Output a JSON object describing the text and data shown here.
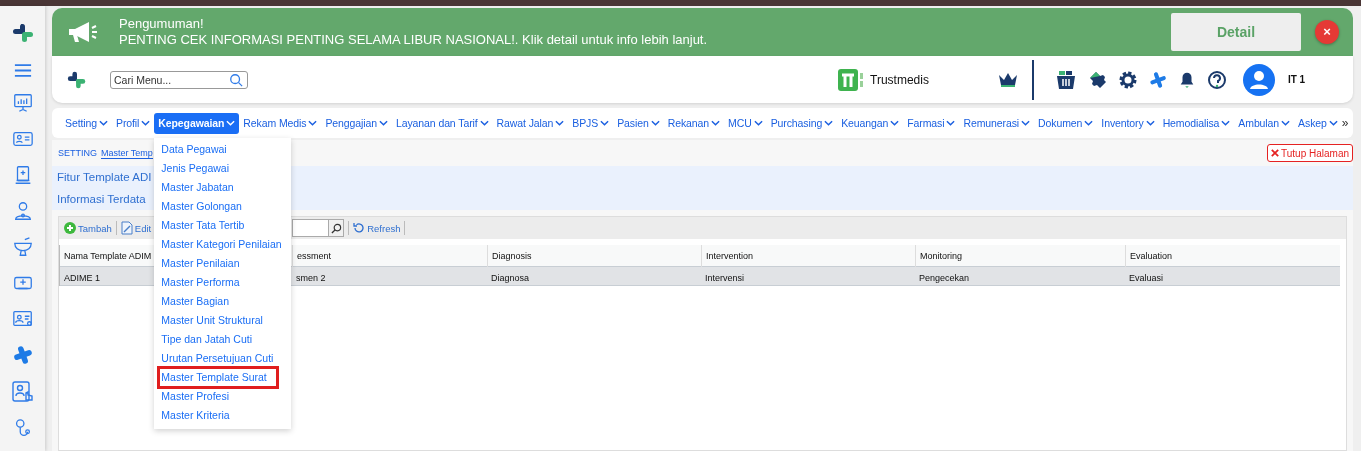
{
  "announcement": {
    "title": "Pengumuman!",
    "message": "PENTING CEK INFORMASI PENTING SELAMA LIBUR NASIONAL!. Klik detail untuk info lebih lanjut.",
    "detail_button": "Detail",
    "close_button": "×"
  },
  "header": {
    "search": {
      "placeholder": "Cari Menu..."
    },
    "brand": "Trustmedis",
    "user": "IT 1"
  },
  "menu": [
    {
      "label": "Setting",
      "selected": false
    },
    {
      "label": "Profil",
      "selected": false
    },
    {
      "label": "Kepegawaian",
      "selected": true
    },
    {
      "label": "Rekam Medis",
      "selected": false
    },
    {
      "label": "Penggajian",
      "selected": false
    },
    {
      "label": "Layanan dan Tarif",
      "selected": false
    },
    {
      "label": "Rawat Jalan",
      "selected": false
    },
    {
      "label": "BPJS",
      "selected": false
    },
    {
      "label": "Pasien",
      "selected": false
    },
    {
      "label": "Rekanan",
      "selected": false
    },
    {
      "label": "MCU",
      "selected": false
    },
    {
      "label": "Purchasing",
      "selected": false
    },
    {
      "label": "Keuangan",
      "selected": false
    },
    {
      "label": "Farmasi",
      "selected": false
    },
    {
      "label": "Remunerasi",
      "selected": false
    },
    {
      "label": "Dokumen",
      "selected": false
    },
    {
      "label": "Inventory",
      "selected": false
    },
    {
      "label": "Hemodialisa",
      "selected": false
    },
    {
      "label": "Ambulan",
      "selected": false
    },
    {
      "label": "Askep",
      "selected": false
    }
  ],
  "menu_more": "»",
  "dropdown": [
    {
      "label": "Data Pegawai",
      "highlighted": false
    },
    {
      "label": "Jenis Pegawai",
      "highlighted": false
    },
    {
      "label": "Master Jabatan",
      "highlighted": false
    },
    {
      "label": "Master Golongan",
      "highlighted": false
    },
    {
      "label": "Master Tata Tertib",
      "highlighted": false
    },
    {
      "label": "Master Kategori Penilaian",
      "highlighted": false
    },
    {
      "label": "Master Penilaian",
      "highlighted": false
    },
    {
      "label": "Master Performa",
      "highlighted": false
    },
    {
      "label": "Master Bagian",
      "highlighted": false
    },
    {
      "label": "Master Unit Struktural",
      "highlighted": false
    },
    {
      "label": "Tipe dan Jatah Cuti",
      "highlighted": false
    },
    {
      "label": "Urutan Persetujuan Cuti",
      "highlighted": false
    },
    {
      "label": "Master Template Surat",
      "highlighted": true
    },
    {
      "label": "Master Profesi",
      "highlighted": false
    },
    {
      "label": "Master Kriteria",
      "highlighted": false
    }
  ],
  "breadcrumb": [
    "SETTING",
    "Master Temp"
  ],
  "close_page": "Tutup Halaman",
  "panel": {
    "title": "Fitur Template ADI",
    "subtitle": "Informasi Terdata"
  },
  "toolbar": {
    "add": "Tambah",
    "edit": "Edit",
    "refresh": "Refresh"
  },
  "table": {
    "columns": [
      "Nama Template ADIM",
      "essment",
      "Diagnosis",
      "Intervention",
      "Monitoring",
      "Evaluation"
    ],
    "rows": [
      [
        "ADIME 1",
        "smen 2",
        "Diagnosa",
        "Intervensi",
        "Pengecekan",
        "Evaluasi"
      ]
    ]
  }
}
